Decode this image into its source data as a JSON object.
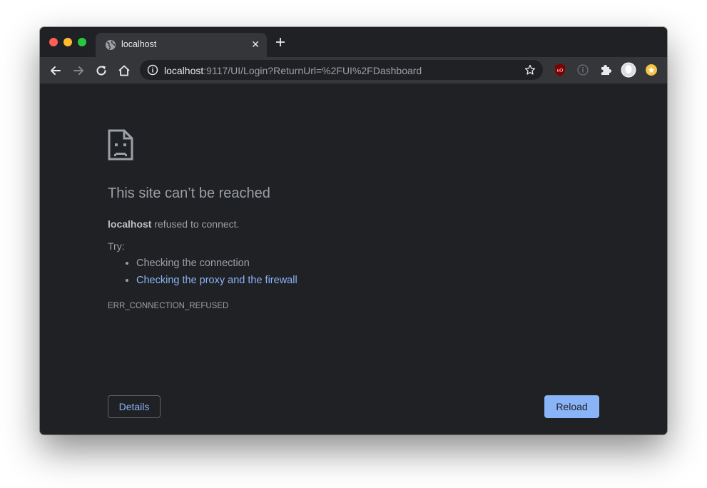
{
  "window": {
    "traffic_lights": [
      "close",
      "minimize",
      "zoom"
    ],
    "tab": {
      "title": "localhost",
      "icon": "globe-icon",
      "close_label": "✕"
    },
    "new_tab_icon": "plus-icon"
  },
  "toolbar": {
    "back_icon": "arrow-left-icon",
    "forward_icon": "arrow-right-icon",
    "reload_icon": "reload-icon",
    "home_icon": "home-icon",
    "address": {
      "host": "localhost",
      "rest": ":9117/UI/Login?ReturnUrl=%2FUI%2FDashboard",
      "info_icon": "info-icon",
      "bookmark_icon": "star-icon"
    },
    "extensions": [
      "ublock-icon",
      "disabled-info-icon",
      "puzzle-icon",
      "profile-avatar",
      "extension-badge-icon"
    ],
    "ublock_label": "uO"
  },
  "error_page": {
    "icon": "sad-document-icon",
    "title": "This site can’t be reached",
    "host": "localhost",
    "message": " refused to connect.",
    "try_label": "Try:",
    "suggestions": {
      "connection": "Checking the connection",
      "proxy": "Checking the proxy and the firewall"
    },
    "error_code": "ERR_CONNECTION_REFUSED",
    "details_label": "Details",
    "reload_label": "Reload"
  },
  "colors": {
    "background": "#202124",
    "toolbar": "#35363a",
    "link": "#8ab4f8",
    "text": "#9aa0a6"
  }
}
